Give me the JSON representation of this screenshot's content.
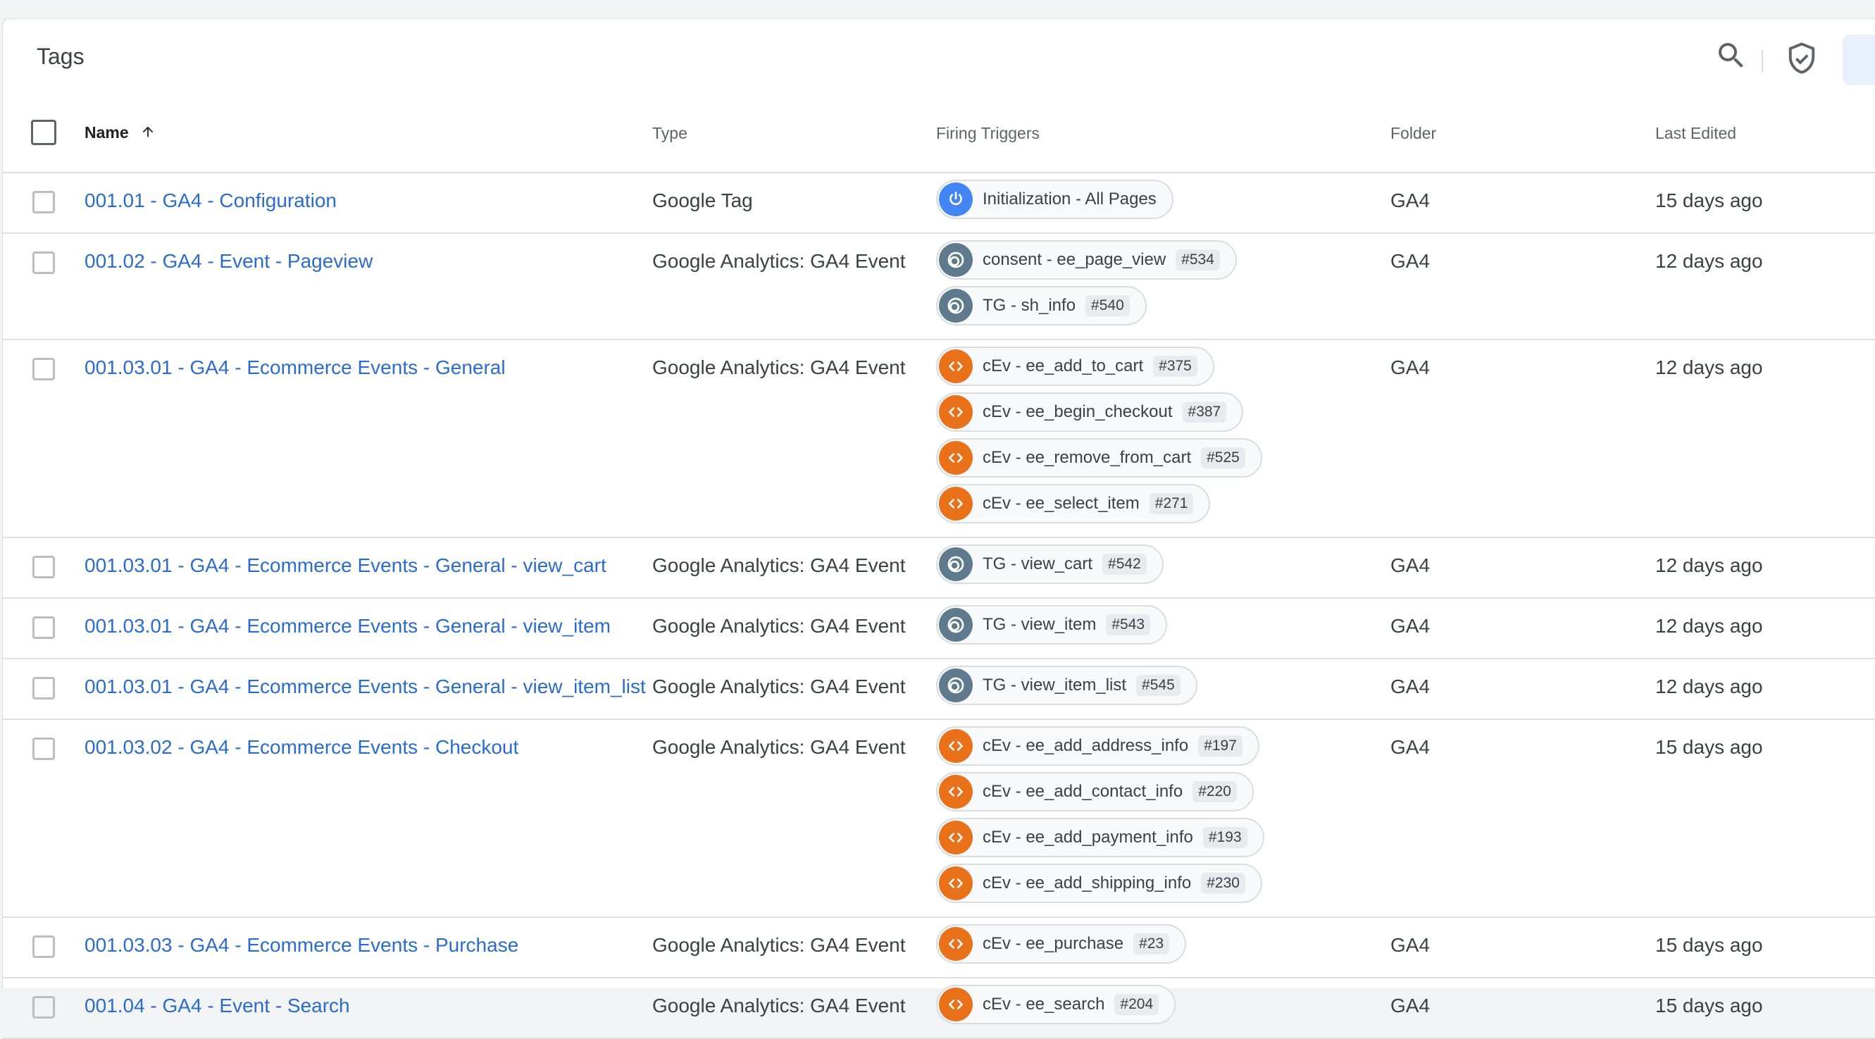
{
  "header": {
    "title": "Tags"
  },
  "columns": {
    "name": "Name",
    "type": "Type",
    "triggers": "Firing Triggers",
    "folder": "Folder",
    "edited": "Last Edited"
  },
  "rows": [
    {
      "name": "001.01 - GA4 - Configuration",
      "type": "Google Tag",
      "folder": "GA4",
      "edited": "15 days ago",
      "triggers": [
        {
          "icon": "power-icon",
          "kind": "init",
          "label": "Initialization - All Pages",
          "id": ""
        }
      ]
    },
    {
      "name": "001.02 - GA4 - Event - Pageview",
      "type": "Google Analytics: GA4 Event",
      "folder": "GA4",
      "edited": "12 days ago",
      "triggers": [
        {
          "icon": "trigger-group-icon",
          "kind": "group",
          "label": "consent - ee_page_view",
          "id": "#534"
        },
        {
          "icon": "trigger-group-icon",
          "kind": "group",
          "label": "TG - sh_info",
          "id": "#540"
        }
      ]
    },
    {
      "name": "001.03.01 - GA4 - Ecommerce Events - General",
      "type": "Google Analytics: GA4 Event",
      "folder": "GA4",
      "edited": "12 days ago",
      "triggers": [
        {
          "icon": "code-icon",
          "kind": "custom",
          "label": "cEv - ee_add_to_cart",
          "id": "#375"
        },
        {
          "icon": "code-icon",
          "kind": "custom",
          "label": "cEv - ee_begin_checkout",
          "id": "#387"
        },
        {
          "icon": "code-icon",
          "kind": "custom",
          "label": "cEv - ee_remove_from_cart",
          "id": "#525"
        },
        {
          "icon": "code-icon",
          "kind": "custom",
          "label": "cEv - ee_select_item",
          "id": "#271"
        }
      ]
    },
    {
      "name": "001.03.01 - GA4 - Ecommerce Events - General - view_cart",
      "type": "Google Analytics: GA4 Event",
      "folder": "GA4",
      "edited": "12 days ago",
      "triggers": [
        {
          "icon": "trigger-group-icon",
          "kind": "group",
          "label": "TG - view_cart",
          "id": "#542"
        }
      ]
    },
    {
      "name": "001.03.01 - GA4 - Ecommerce Events - General - view_item",
      "type": "Google Analytics: GA4 Event",
      "folder": "GA4",
      "edited": "12 days ago",
      "triggers": [
        {
          "icon": "trigger-group-icon",
          "kind": "group",
          "label": "TG - view_item",
          "id": "#543"
        }
      ]
    },
    {
      "name": "001.03.01 - GA4 - Ecommerce Events - General - view_item_list",
      "type": "Google Analytics: GA4 Event",
      "folder": "GA4",
      "edited": "12 days ago",
      "triggers": [
        {
          "icon": "trigger-group-icon",
          "kind": "group",
          "label": "TG - view_item_list",
          "id": "#545"
        }
      ]
    },
    {
      "name": "001.03.02 - GA4 - Ecommerce Events - Checkout",
      "type": "Google Analytics: GA4 Event",
      "folder": "GA4",
      "edited": "15 days ago",
      "triggers": [
        {
          "icon": "code-icon",
          "kind": "custom",
          "label": "cEv - ee_add_address_info",
          "id": "#197"
        },
        {
          "icon": "code-icon",
          "kind": "custom",
          "label": "cEv - ee_add_contact_info",
          "id": "#220"
        },
        {
          "icon": "code-icon",
          "kind": "custom",
          "label": "cEv - ee_add_payment_info",
          "id": "#193"
        },
        {
          "icon": "code-icon",
          "kind": "custom",
          "label": "cEv - ee_add_shipping_info",
          "id": "#230"
        }
      ]
    },
    {
      "name": "001.03.03 - GA4 - Ecommerce Events - Purchase",
      "type": "Google Analytics: GA4 Event",
      "folder": "GA4",
      "edited": "15 days ago",
      "triggers": [
        {
          "icon": "code-icon",
          "kind": "custom",
          "label": "cEv - ee_purchase",
          "id": "#23"
        }
      ]
    },
    {
      "name": "001.04 - GA4 - Event - Search",
      "type": "Google Analytics: GA4 Event",
      "folder": "GA4",
      "edited": "15 days ago",
      "triggers": [
        {
          "icon": "code-icon",
          "kind": "custom",
          "label": "cEv - ee_search",
          "id": "#204"
        }
      ]
    }
  ],
  "colors": {
    "link": "#2a6ccd",
    "init_icon": "#4285f4",
    "group_icon": "#5f7a8c",
    "custom_icon": "#e8711a"
  }
}
